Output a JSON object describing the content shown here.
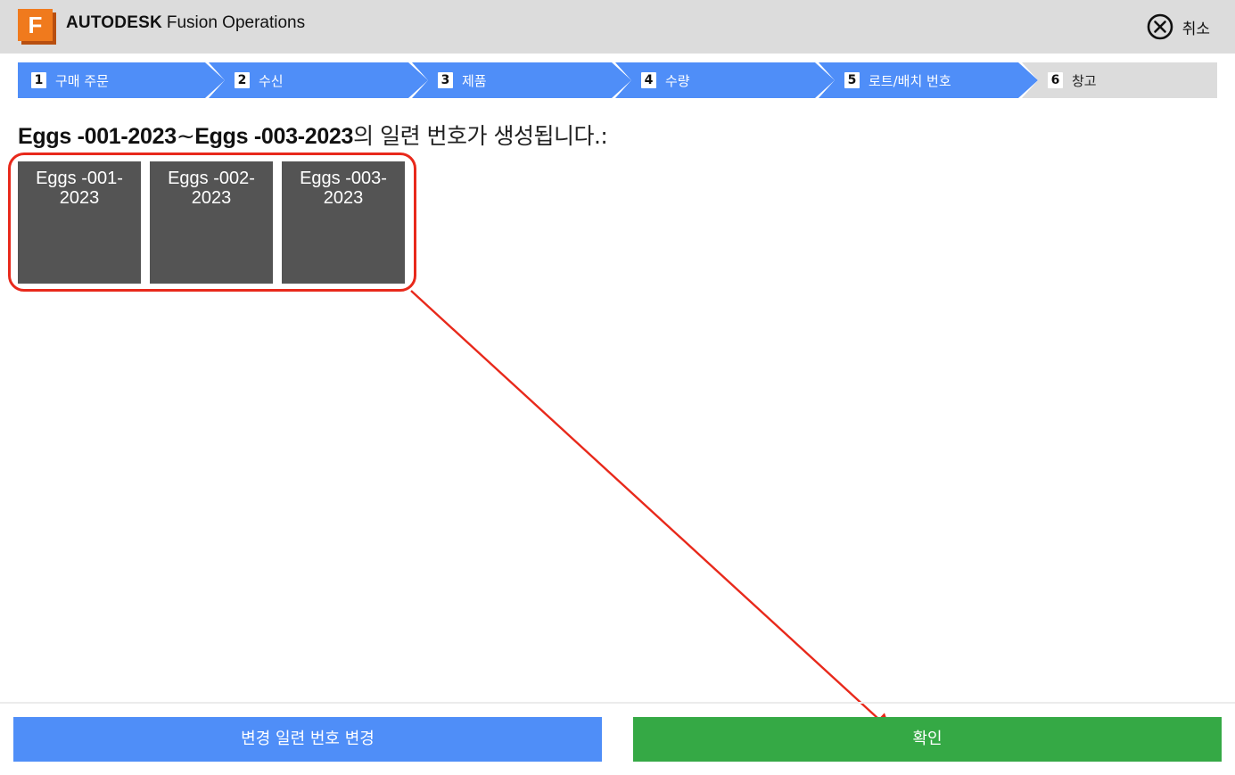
{
  "app": {
    "logo_letter": "F",
    "brand_bold": "AUTODESK",
    "brand_rest": "Fusion Operations",
    "cancel_label": "취소"
  },
  "steps": [
    {
      "num": "1",
      "label": "구매 주문",
      "state": "done"
    },
    {
      "num": "2",
      "label": "수신",
      "state": "done"
    },
    {
      "num": "3",
      "label": "제품",
      "state": "done"
    },
    {
      "num": "4",
      "label": "수량",
      "state": "done"
    },
    {
      "num": "5",
      "label": "로트/배치 번호",
      "state": "current"
    },
    {
      "num": "6",
      "label": "창고",
      "state": "pending"
    }
  ],
  "headline": {
    "from": "Eggs -001-2023",
    "tilde": "~",
    "to": "Eggs -003-2023",
    "suffix": "의 일련 번호가 생성됩니다.:"
  },
  "serials": [
    {
      "line1": "Eggs -001-",
      "line2": "2023"
    },
    {
      "line1": "Eggs -002-",
      "line2": "2023"
    },
    {
      "line1": "Eggs -003-",
      "line2": "2023"
    }
  ],
  "buttons": {
    "change_label": "변경 일련 번호 변경",
    "ok_label": "확인"
  },
  "colors": {
    "step_active": "#4f8ef8",
    "step_inactive": "#dcdcdc",
    "tile": "#545454",
    "change_button": "#4f8ef8",
    "ok_button": "#35a945",
    "annotation": "#e8291b"
  }
}
